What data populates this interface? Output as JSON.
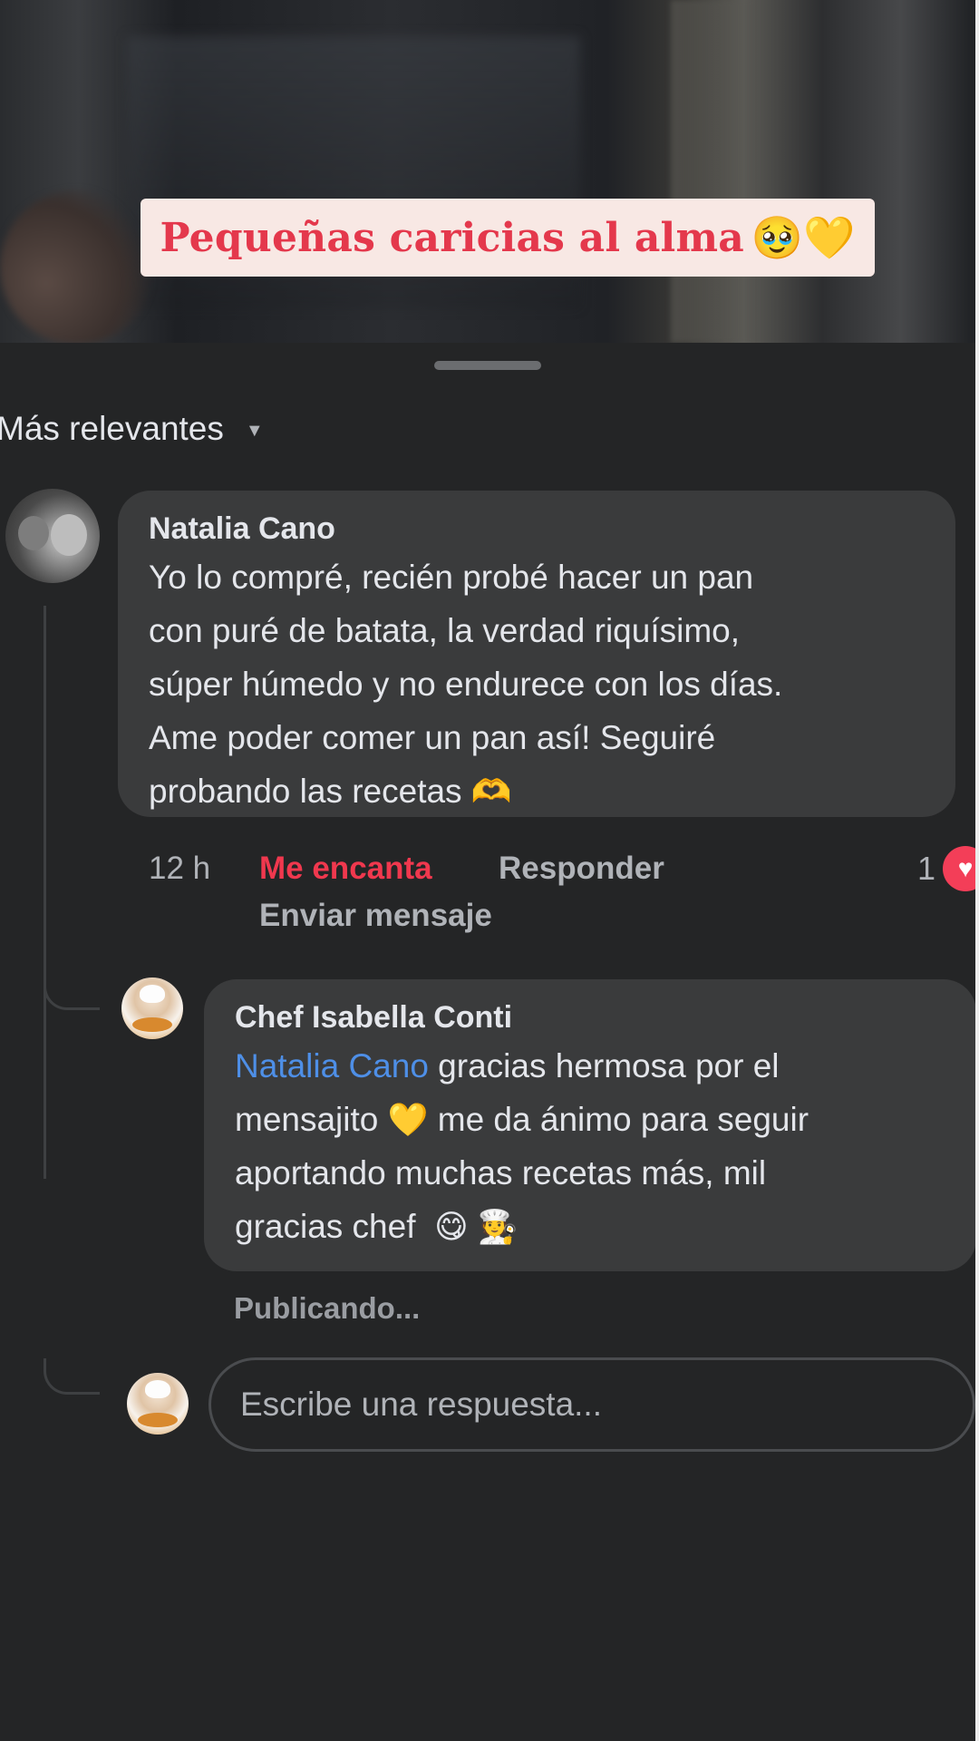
{
  "video": {
    "caption_text": "Pequeñas caricias al alma",
    "caption_emoji": "🥹💛"
  },
  "comments": {
    "sort_label": "Más relevantes",
    "main": {
      "author": "Natalia Cano",
      "text_lines": [
        "Yo lo compré, recién probé hacer un pan",
        "con puré de batata, la verdad riquísimo,",
        "súper húmedo y no endurece con los días.",
        "Ame poder comer un pan así! Seguiré",
        "probando las recetas"
      ],
      "trailing_emoji": "🫶",
      "time": "12 h",
      "reaction_label": "Me encanta",
      "reply_label": "Responder",
      "send_message_label": "Enviar mensaje",
      "reaction_count": "1",
      "reaction_icon": "heart-icon"
    },
    "reply": {
      "author": "Chef Isabella Conti",
      "mention": "Natalia Cano",
      "line1_after_mention": " gracias hermosa por el",
      "line2_a": "mensajito",
      "line2_emoji": "💛",
      "line2_b": " me da ánimo para seguir",
      "line3": "aportando muchas recetas más, mil",
      "line4": "gracias chef",
      "line4_emojis": "😋 🧑‍🍳",
      "status": "Publicando..."
    },
    "reply_input": {
      "placeholder": "Escribe una respuesta..."
    }
  },
  "colors": {
    "caption_text": "#e4384c",
    "reaction_active": "#f0384e",
    "mention": "#4e8fe7",
    "sheet_bg": "#242526",
    "bubble_bg": "#3a3b3c"
  }
}
